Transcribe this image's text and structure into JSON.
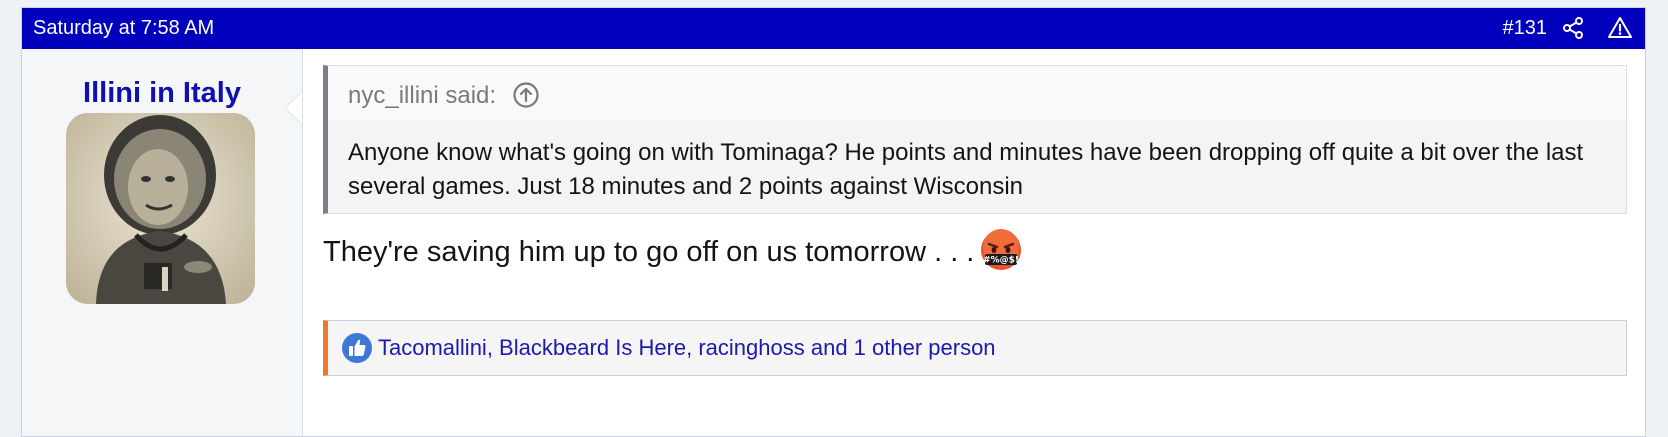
{
  "post": {
    "date": "Saturday at 7:58 AM",
    "number": "#131",
    "header_bg": "#0000bd",
    "share_icon": "share-icon",
    "report_icon": "warning-icon"
  },
  "author": {
    "username": "Illini in Italy",
    "username_color": "#1010b0",
    "avatar": "avatar-photo"
  },
  "quote": {
    "author_label": "nyc_illini said:",
    "jump_icon": "arrow-up-circle-icon",
    "text": "Anyone know what's going on with Tominaga? He points and minutes have been dropping off quite a bit over the last several games. Just 18 minutes and 2 points against Wisconsin"
  },
  "message": {
    "text": "They're saving him up to go off on us tomorrow . . .",
    "emoji": "cursing-face-emoji"
  },
  "reactions": {
    "icon": "thumbs-up-icon",
    "text": "Tacomallini, Blackbeard Is Here, racinghoss and 1 other person",
    "accent": "#f07a2a"
  }
}
